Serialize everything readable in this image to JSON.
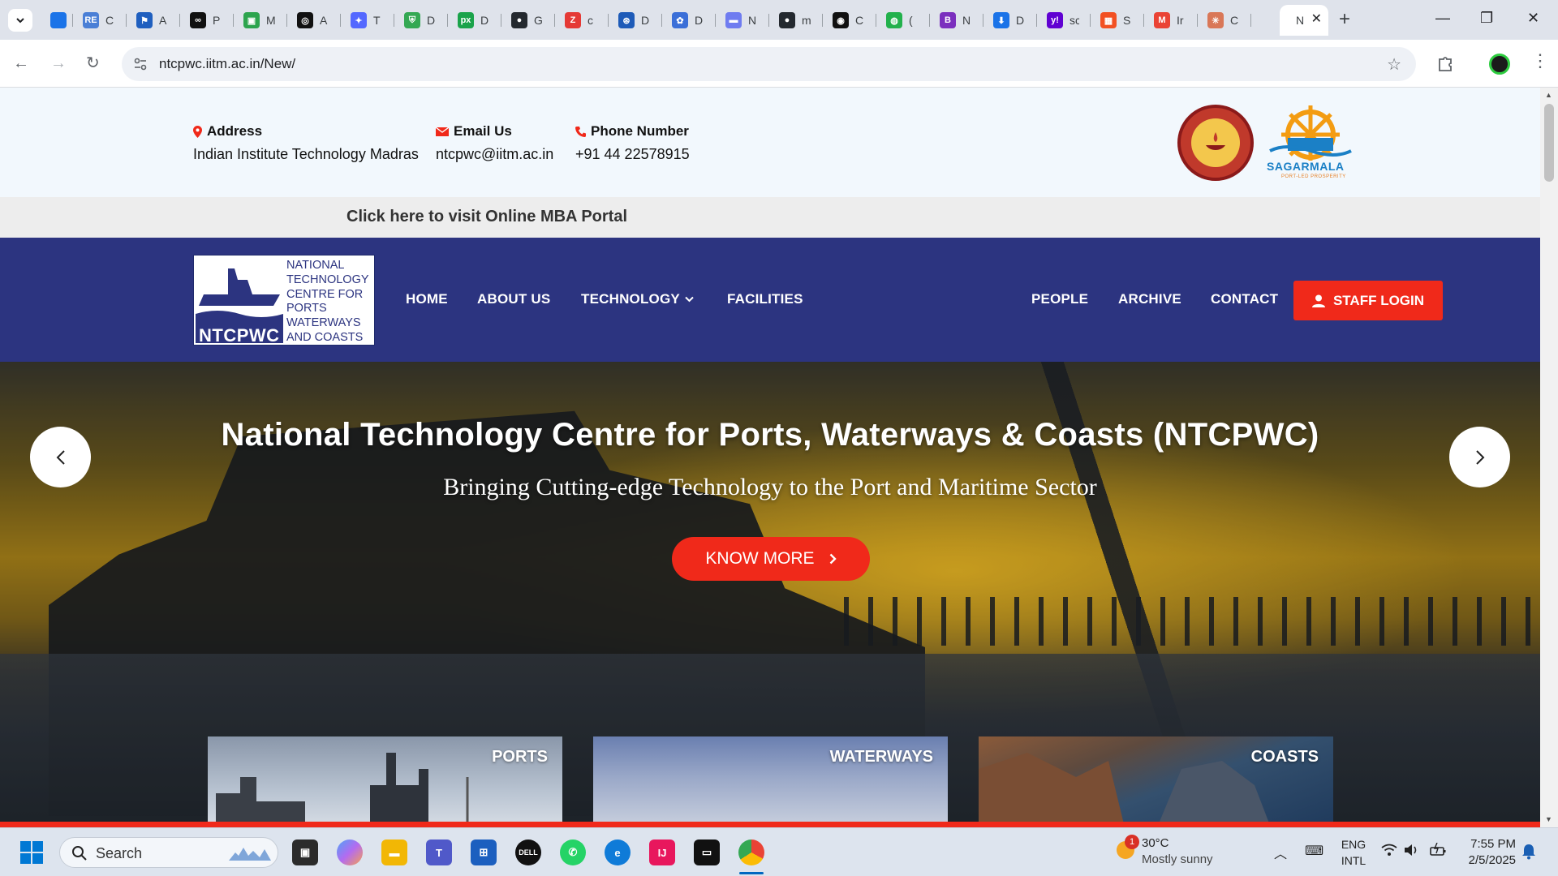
{
  "browser": {
    "tabs": [
      {
        "title": "C",
        "favicon_text": "RE",
        "color": "#4a7fd6"
      },
      {
        "title": "A",
        "favicon_text": "⚑",
        "color": "#1f5fbf"
      },
      {
        "title": "P",
        "favicon_text": "∞",
        "color": "#111111"
      },
      {
        "title": "M",
        "favicon_text": "▣",
        "color": "#2da44e"
      },
      {
        "title": "A",
        "favicon_text": "◎",
        "color": "#111111"
      },
      {
        "title": "T",
        "favicon_text": "✦",
        "color": "#5468ff"
      },
      {
        "title": "D",
        "favicon_text": "⛨",
        "color": "#34a853"
      },
      {
        "title": "D",
        "favicon_text": "px",
        "color": "#1aa34a"
      },
      {
        "title": "G",
        "favicon_text": "●",
        "color": "#24292f"
      },
      {
        "title": "c",
        "favicon_text": "Z",
        "color": "#e53935"
      },
      {
        "title": "D",
        "favicon_text": "⊛",
        "color": "#1e5bb8"
      },
      {
        "title": "D",
        "favicon_text": "✿",
        "color": "#3b6fd8"
      },
      {
        "title": "N",
        "favicon_text": "▬",
        "color": "#6f7cf0"
      },
      {
        "title": "m",
        "favicon_text": "●",
        "color": "#24292f"
      },
      {
        "title": "C",
        "favicon_text": "◉",
        "color": "#111111"
      },
      {
        "title": "(",
        "favicon_text": "◍",
        "color": "#22b14c"
      },
      {
        "title": "N",
        "favicon_text": "B",
        "color": "#7b2fbe"
      },
      {
        "title": "D",
        "favicon_text": "⬇",
        "color": "#1a73e8"
      },
      {
        "title": "sc",
        "favicon_text": "y!",
        "color": "#6001d2"
      },
      {
        "title": "S",
        "favicon_text": "▦",
        "color": "#f25022"
      },
      {
        "title": "Ir",
        "favicon_text": "M",
        "color": "#ea4335"
      },
      {
        "title": "C",
        "favicon_text": "✳",
        "color": "#d97757"
      }
    ],
    "active_tab": {
      "title": "N"
    },
    "new_tab": "+",
    "url": "ntcpwc.iitm.ac.in/New/"
  },
  "header": {
    "address_label": "Address",
    "address_value": "Indian Institute Technology Madras",
    "email_label": "Email Us",
    "email_value": "ntcpwc@iitm.ac.in",
    "phone_label": "Phone Number",
    "phone_value": "+91 44 22578915",
    "sagarmala_text": "SAGARMALA",
    "sagarmala_tagline": "PORT-LED PROSPERITY"
  },
  "mba_link": "Click here to visit Online MBA Portal",
  "logo": {
    "abbr": "NTCPWC",
    "full": "NATIONAL TECHNOLOGY CENTRE FOR PORTS WATERWAYS AND COASTS"
  },
  "nav": {
    "home": "HOME",
    "about": "ABOUT US",
    "technology": "TECHNOLOGY",
    "facilities": "FACILITIES",
    "people": "PEOPLE",
    "archive": "ARCHIVE",
    "contact": "CONTACT",
    "staff_login": "STAFF LOGIN"
  },
  "hero": {
    "title": "National Technology Centre for Ports, Waterways & Coasts (NTCPWC)",
    "subtitle": "Bringing Cutting-edge Technology to the Port and Maritime Sector",
    "cta": "KNOW MORE"
  },
  "cards": [
    {
      "label": "PORTS"
    },
    {
      "label": "WATERWAYS"
    },
    {
      "label": "COASTS"
    }
  ],
  "taskbar": {
    "search_placeholder": "Search",
    "weather_temp": "30°C",
    "weather_desc": "Mostly sunny",
    "weather_badge": "1",
    "lang_1": "ENG",
    "lang_2": "INTL",
    "time": "7:55 PM",
    "date": "2/5/2025"
  },
  "colors": {
    "nav_bg": "#2c3480",
    "accent_red": "#f0291a",
    "info_bg": "#f2f8fd"
  }
}
